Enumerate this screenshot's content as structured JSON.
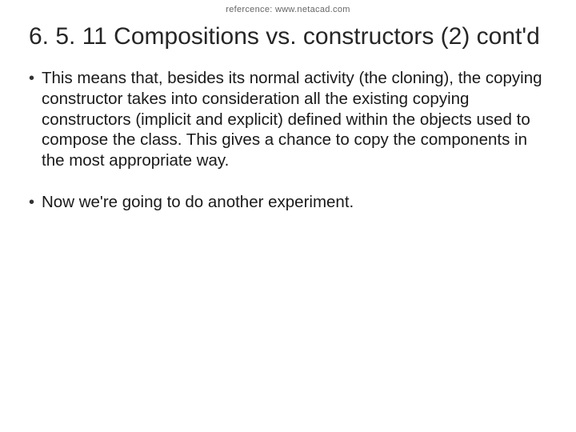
{
  "reference": "refercence: www.netacad.com",
  "title": "6. 5. 11 Compositions vs. constructors (2) cont'd",
  "bullets": [
    {
      "text": "This means that, besides its normal activity (the cloning), the copying constructor takes into consideration all the existing copying constructors (implicit and explicit) defined within the objects used to compose the class. This gives a chance to copy the components in the most appropriate way."
    },
    {
      "text": "Now we're going to do another experiment."
    }
  ]
}
